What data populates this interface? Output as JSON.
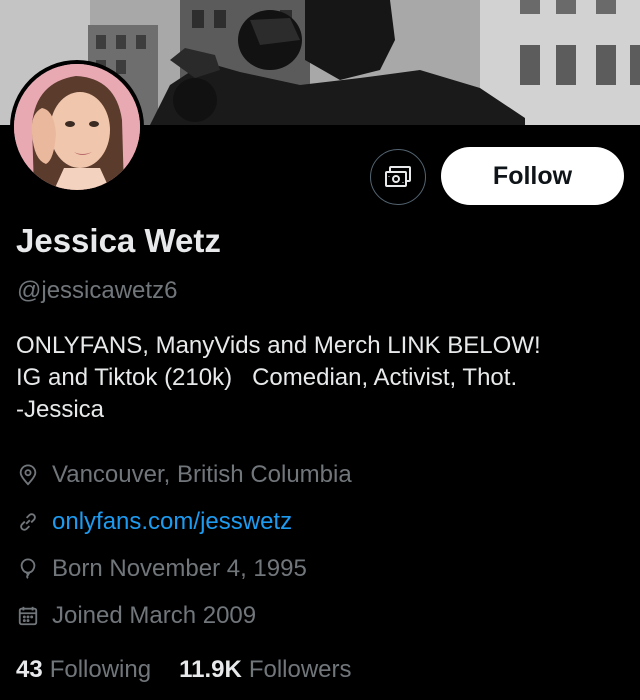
{
  "profile": {
    "name": "Jessica Wetz",
    "handle": "@jessicawetz6",
    "bio": [
      "ONLYFANS, ManyVids and Merch LINK BELOW!",
      "IG and Tiktok (210k)   Comedian, Activist, Thot.",
      "-Jessica"
    ],
    "location": "Vancouver, British Columbia",
    "website": "onlyfans.com/jesswetz",
    "birthday": "Born November 4, 1995",
    "joined": "Joined March 2009"
  },
  "actions": {
    "follow_label": "Follow",
    "tip_icon": "money-icon"
  },
  "stats": {
    "following_count": "43",
    "following_label": "Following",
    "followers_count": "11.9K",
    "followers_label": "Followers"
  },
  "icons": {
    "location": "location-pin-icon",
    "website": "link-icon",
    "birthday": "balloon-icon",
    "joined": "calendar-icon"
  },
  "colors": {
    "background": "#000000",
    "primary_text": "#e7e9ea",
    "secondary_text": "#71767b",
    "link": "#1d9bf0",
    "follow_button_bg": "#ffffff"
  }
}
